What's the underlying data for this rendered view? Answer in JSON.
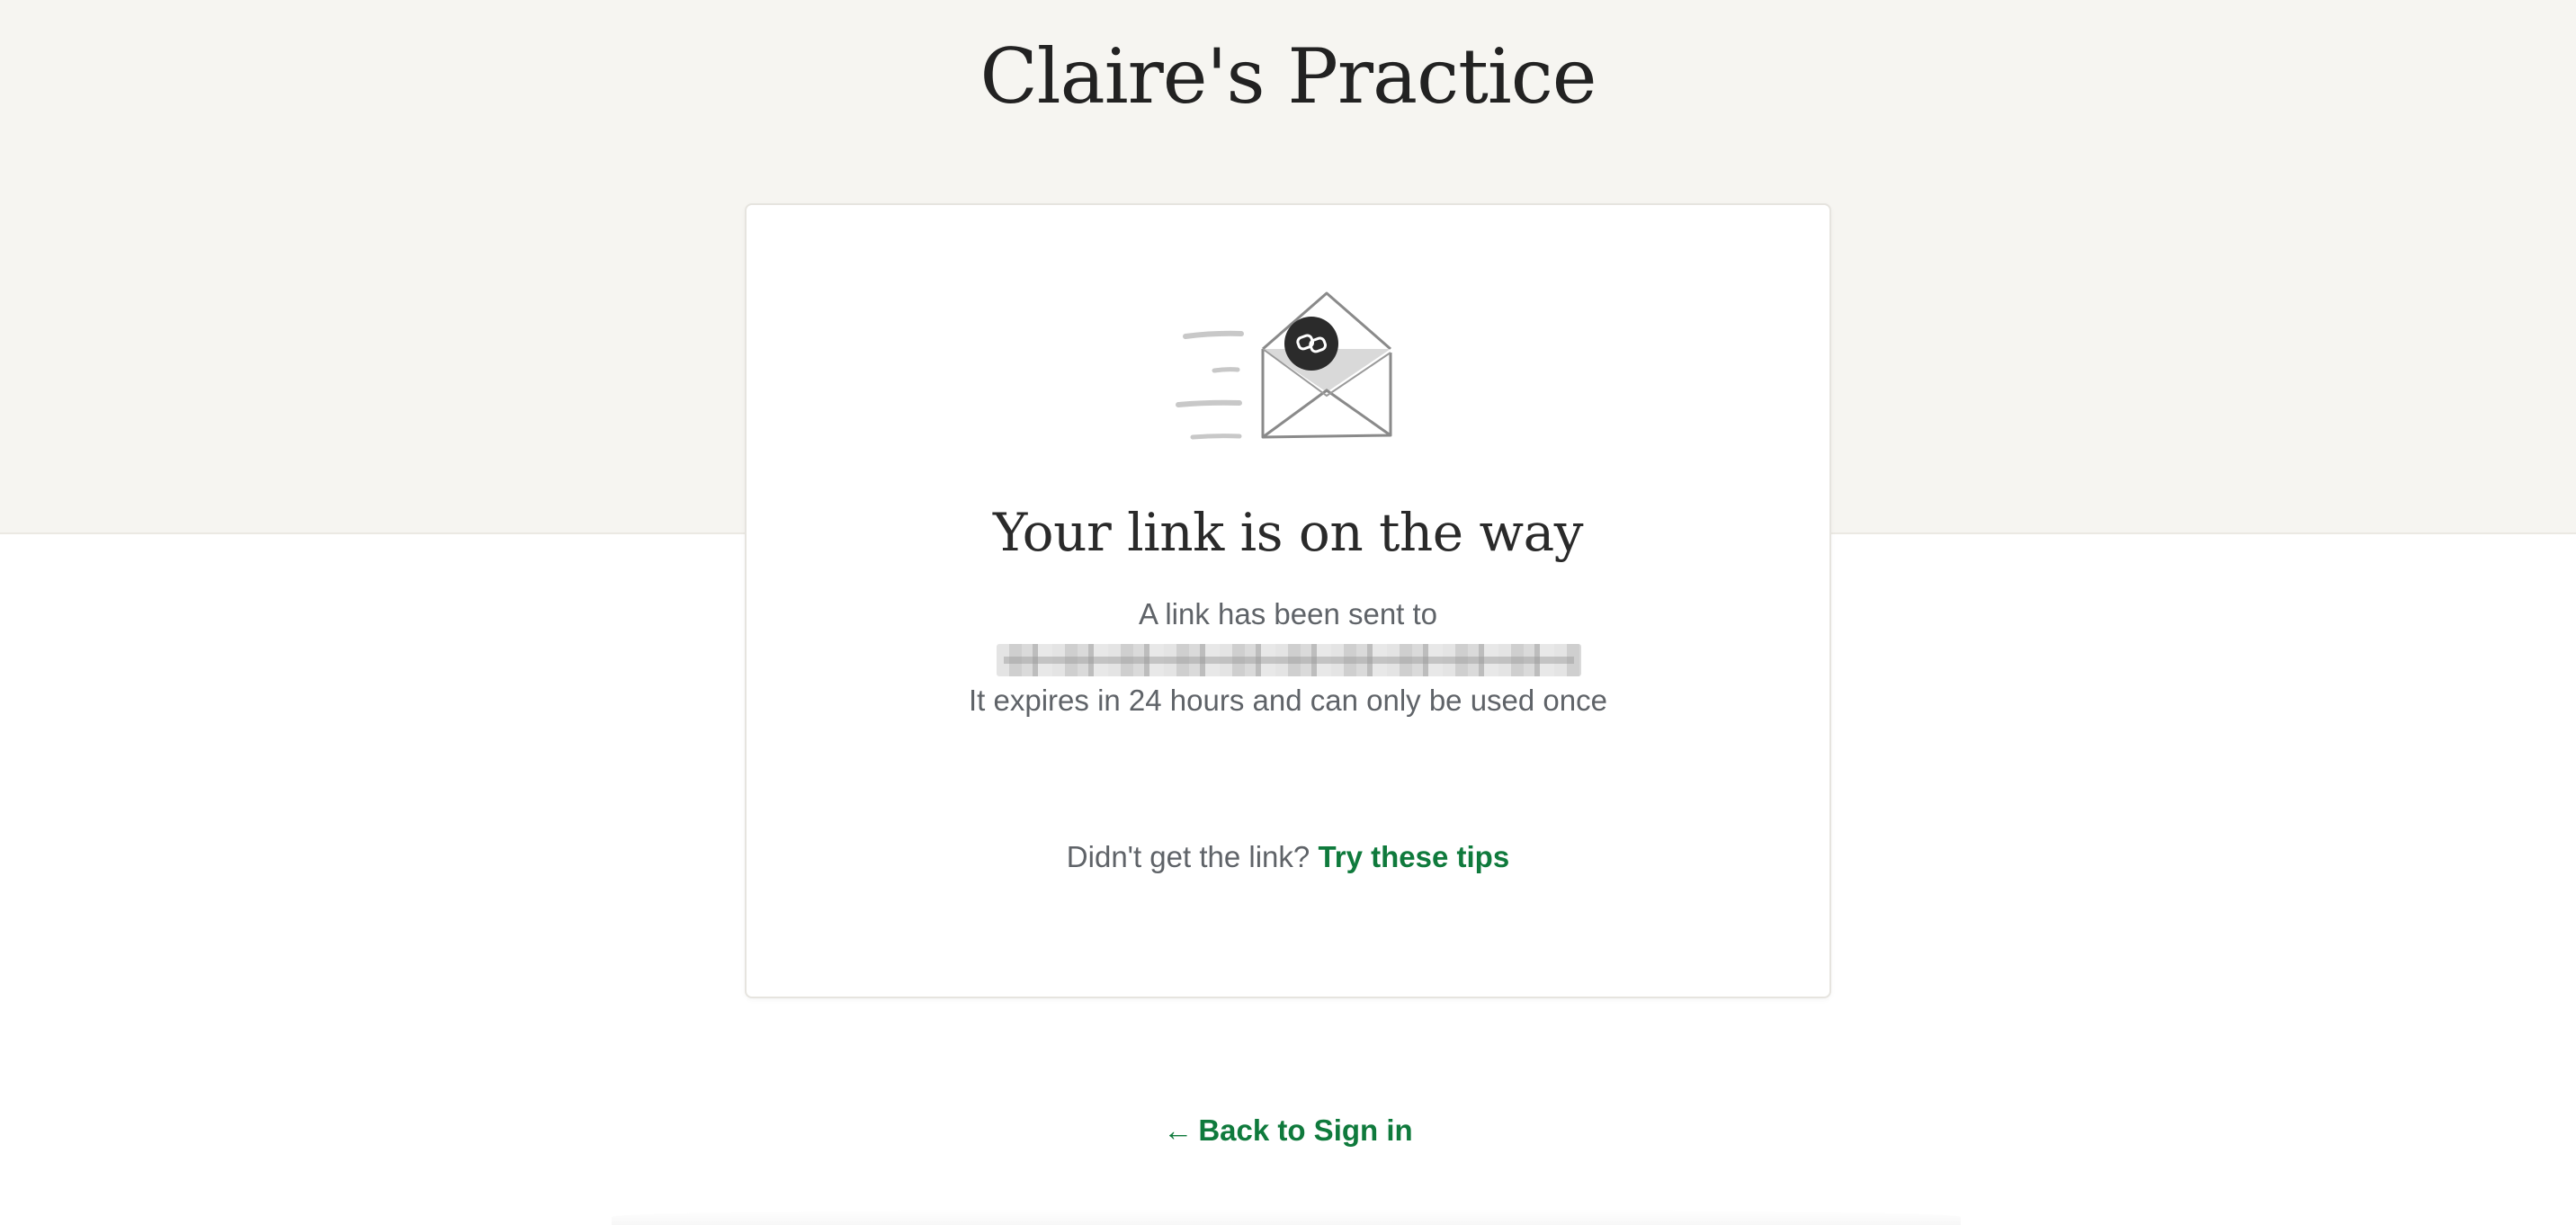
{
  "header": {
    "title": "Claire's Practice"
  },
  "card": {
    "illustration_icon": "envelope-link-icon",
    "heading": "Your link is on the way",
    "sent_to_text": "A link has been sent to",
    "expires_text": "It expires in 24 hours and can only be used once",
    "tips_prompt": "Didn't get the link?",
    "tips_link": "Try these tips"
  },
  "footer": {
    "back_arrow": "←",
    "back_label": "Back to Sign in"
  },
  "colors": {
    "accent": "#0f7a3c",
    "band_background": "#f6f5f1",
    "text_muted": "#5f6368",
    "heading_text": "#222222"
  }
}
